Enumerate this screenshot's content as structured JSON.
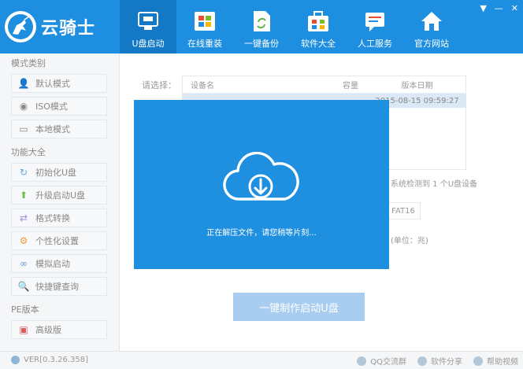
{
  "app": {
    "logo_text": "云骑士",
    "colors": {
      "header": "#1e8fe0",
      "active_tab": "#1379c6",
      "overlay": "#1f8fe0"
    }
  },
  "nav": [
    {
      "label": "U盘启动",
      "icon": "usb-drive-icon",
      "active": true
    },
    {
      "label": "在线重装",
      "icon": "windows-logo-icon",
      "active": false
    },
    {
      "label": "一键备份",
      "icon": "backup-file-icon",
      "active": false
    },
    {
      "label": "软件大全",
      "icon": "software-bag-icon",
      "active": false
    },
    {
      "label": "人工服务",
      "icon": "chat-service-icon",
      "active": false
    },
    {
      "label": "官方网站",
      "icon": "home-icon",
      "active": false
    }
  ],
  "window_controls": {
    "menu": "▼",
    "minimize": "—",
    "close": "✕"
  },
  "sidebar": {
    "sections": [
      {
        "title": "模式类别",
        "items": [
          {
            "label": "默认模式",
            "icon": "person-icon"
          },
          {
            "label": "ISO模式",
            "icon": "disc-icon"
          },
          {
            "label": "本地模式",
            "icon": "monitor-icon"
          }
        ]
      },
      {
        "title": "功能大全",
        "items": [
          {
            "label": "初始化U盘",
            "icon": "refresh-icon"
          },
          {
            "label": "升级启动U盘",
            "icon": "arrow-up-icon"
          },
          {
            "label": "格式转换",
            "icon": "swap-icon"
          },
          {
            "label": "个性化设置",
            "icon": "gear-icon"
          },
          {
            "label": "模拟启动",
            "icon": "link-icon"
          },
          {
            "label": "快捷键查询",
            "icon": "search-icon"
          }
        ]
      },
      {
        "title": "PE版本",
        "items": [
          {
            "label": "高级版",
            "icon": "badge-icon"
          }
        ]
      }
    ]
  },
  "main": {
    "choose_label": "请选择：",
    "table": {
      "headers": {
        "name": "设备名",
        "capacity": "容量",
        "date": "版本日期"
      },
      "row": {
        "name": "",
        "capacity": "",
        "date": "2015-08-15 09:59:27"
      }
    },
    "side_note": "系统检测到 1 个U盘设备",
    "fat_label": "FAT16",
    "unit_note": "(单位：兆)",
    "make_button": "一键制作启动U盘"
  },
  "overlay": {
    "message": "正在解压文件，请您稍等片刻..."
  },
  "footer": {
    "version": "VER[0.3.26.358]",
    "links": [
      {
        "label": "QQ交流群",
        "icon": "qq-icon"
      },
      {
        "label": "软件分享",
        "icon": "share-icon"
      },
      {
        "label": "帮助视频",
        "icon": "help-icon"
      }
    ]
  }
}
